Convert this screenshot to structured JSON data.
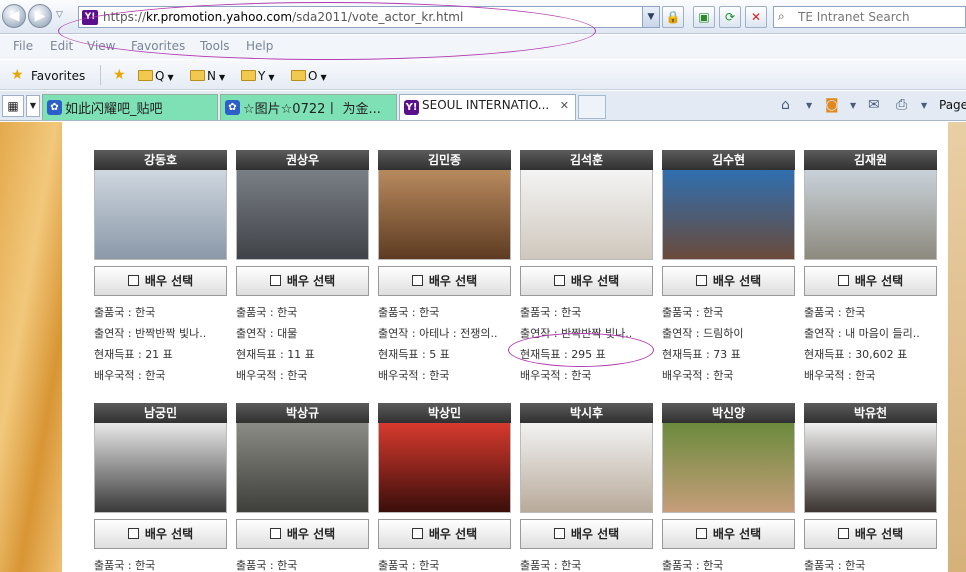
{
  "browser": {
    "url": {
      "prefix": "https://",
      "domain": "kr.promotion.yahoo.com",
      "path": "/sda2011/vote_actor_kr.html",
      "favicon": "Y!"
    },
    "search_placeholder": "TE Intranet Search",
    "menu": [
      "File",
      "Edit",
      "View",
      "Favorites",
      "Tools",
      "Help"
    ],
    "favorites_label": "Favorites",
    "folders": [
      "Q",
      "N",
      "Y",
      "O"
    ],
    "tabs": [
      {
        "label": "如此闪耀吧_贴吧",
        "icon": "paw-icon"
      },
      {
        "label": "☆图片☆0722丨 为金...",
        "icon": "paw-icon"
      },
      {
        "label": "SEOUL INTERNATIO...",
        "icon": "yahoo-icon",
        "active": true
      }
    ],
    "command_text": "Page"
  },
  "page": {
    "labels": {
      "select": "배우 선택",
      "country": "출품국 : ",
      "work": "출연작 : ",
      "votes": "현재득표 : ",
      "nationality": "배우국적 : ",
      "vote_unit": " 표"
    },
    "actors_row1": [
      {
        "name": "강동호",
        "country": "한국",
        "work": "반짝반짝 빛나..",
        "votes": "21",
        "nationality": "한국"
      },
      {
        "name": "권상우",
        "country": "한국",
        "work": "대물",
        "votes": "11",
        "nationality": "한국"
      },
      {
        "name": "김민종",
        "country": "한국",
        "work": "아테나 : 전쟁의..",
        "votes": "5",
        "nationality": "한국"
      },
      {
        "name": "김석훈",
        "country": "한국",
        "work": "반짝반짝 빛나..",
        "votes": "295",
        "nationality": "한국"
      },
      {
        "name": "김수현",
        "country": "한국",
        "work": "드림하이",
        "votes": "73",
        "nationality": "한국"
      },
      {
        "name": "김재원",
        "country": "한국",
        "work": "내 마음이 들리..",
        "votes": "30,602",
        "nationality": "한국"
      }
    ],
    "actors_row2": [
      {
        "name": "남궁민",
        "country": "한국"
      },
      {
        "name": "박상규",
        "country": "한국"
      },
      {
        "name": "박상민",
        "country": "한국"
      },
      {
        "name": "박시후",
        "country": "한국"
      },
      {
        "name": "박신양",
        "country": "한국"
      },
      {
        "name": "박유천",
        "country": "한국"
      }
    ]
  }
}
